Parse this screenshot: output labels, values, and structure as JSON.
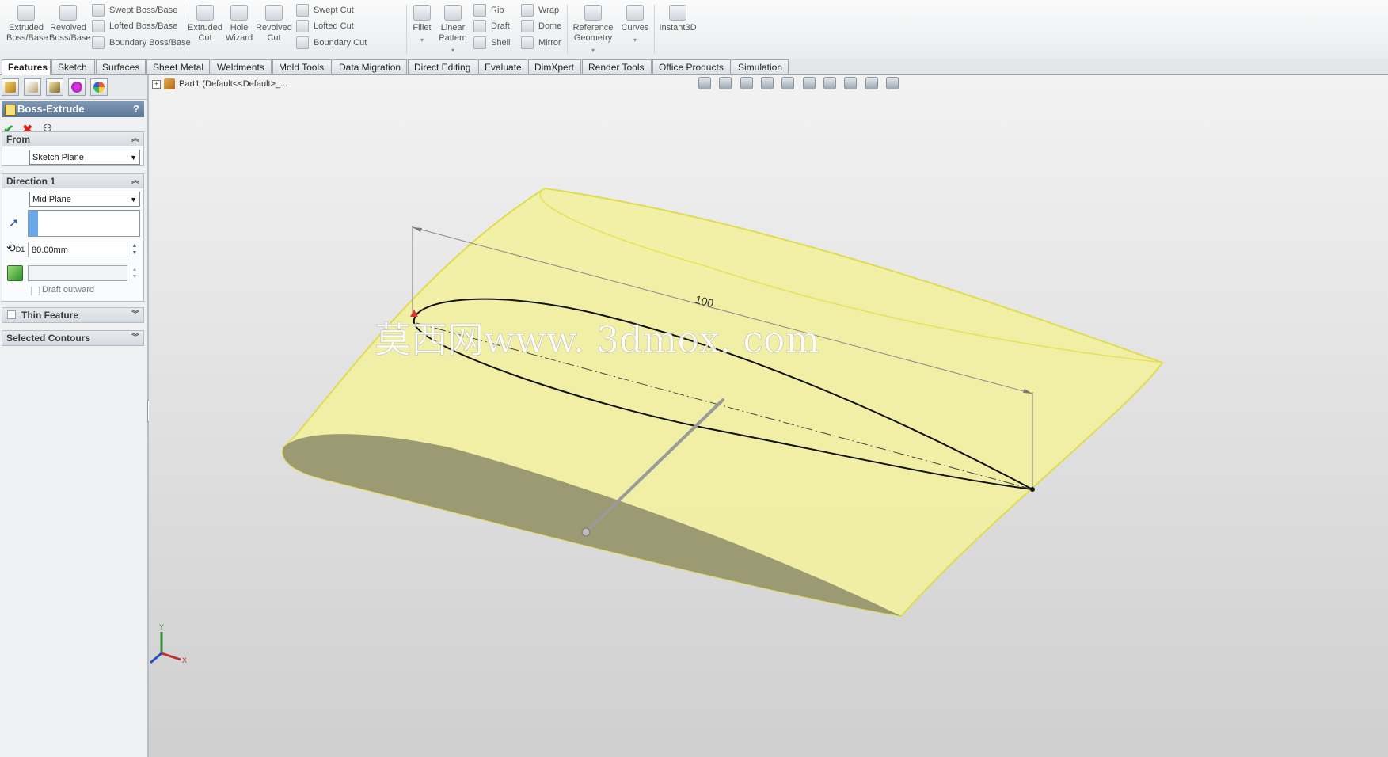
{
  "ribbon": {
    "buttons": {
      "extruded_boss": "Extruded Boss/Base",
      "revolved_boss": "Revolved Boss/Base",
      "swept_boss": "Swept Boss/Base",
      "lofted_boss": "Lofted Boss/Base",
      "boundary_boss": "Boundary Boss/Base",
      "extruded_cut": "Extruded Cut",
      "hole_wizard": "Hole Wizard",
      "revolved_cut": "Revolved Cut",
      "swept_cut": "Swept Cut",
      "lofted_cut": "Lofted Cut",
      "boundary_cut": "Boundary Cut",
      "fillet": "Fillet",
      "linear_pattern": "Linear Pattern",
      "rib": "Rib",
      "draft": "Draft",
      "shell": "Shell",
      "wrap": "Wrap",
      "dome": "Dome",
      "mirror": "Mirror",
      "reference_geometry": "Reference Geometry",
      "curves": "Curves",
      "instant3d": "Instant3D"
    }
  },
  "tabs": [
    "Features",
    "Sketch",
    "Surfaces",
    "Sheet Metal",
    "Weldments",
    "Mold Tools",
    "Data Migration",
    "Direct Editing",
    "Evaluate",
    "DimXpert",
    "Render Tools",
    "Office Products",
    "Simulation"
  ],
  "property_manager": {
    "title": "Boss-Extrude",
    "help": "?",
    "from": {
      "header": "From",
      "value": "Sketch Plane"
    },
    "direction1": {
      "header": "Direction 1",
      "end_condition": "Mid Plane",
      "depth": "80.00mm",
      "depth_icon_label": "D1",
      "draft_outward": "Draft outward"
    },
    "thin_feature": "Thin Feature",
    "selected_contours": "Selected Contours"
  },
  "viewport": {
    "tree_label": "Part1  (Default<<Default>_...",
    "dimension": "100",
    "watermark": "莫西网www. 3dmox. com",
    "triad": {
      "y": "Y",
      "x": "X"
    }
  },
  "colors": {
    "part_fill": "#f2f0a0",
    "part_edge": "#e0dc50",
    "shadow_face": "#9c9a72"
  }
}
